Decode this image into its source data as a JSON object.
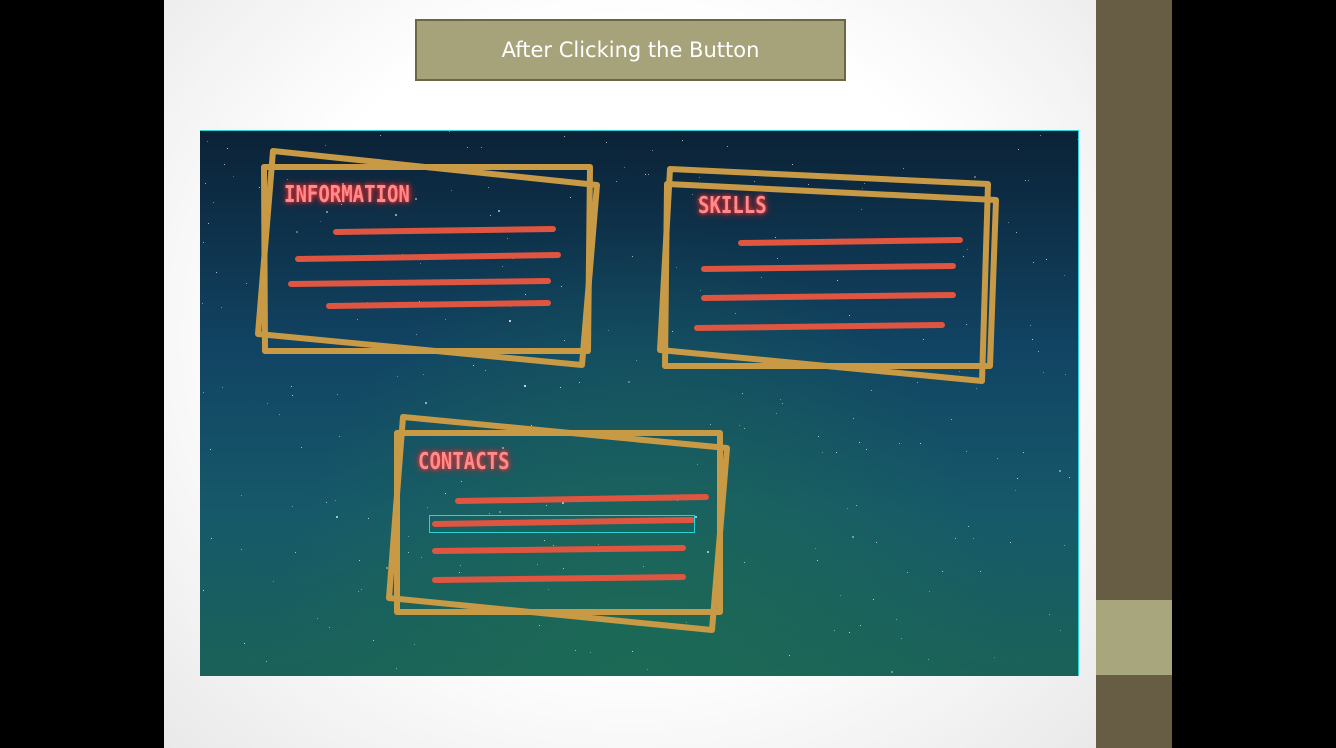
{
  "title_button": {
    "label": "After Clicking  the Button"
  },
  "panels": [
    {
      "heading": "INFORMATION",
      "lines": 4
    },
    {
      "heading": "SKILLS",
      "lines": 4
    },
    {
      "heading": "CONTACTS",
      "lines": 4,
      "selected_line": 2
    }
  ],
  "colors": {
    "frame": "#c99a45",
    "stroke": "#e0553f",
    "heading": "#ff8c8c",
    "selection": "#2ad3d8",
    "title_fill": "#a6a27a",
    "sidebar": "#675d45"
  }
}
